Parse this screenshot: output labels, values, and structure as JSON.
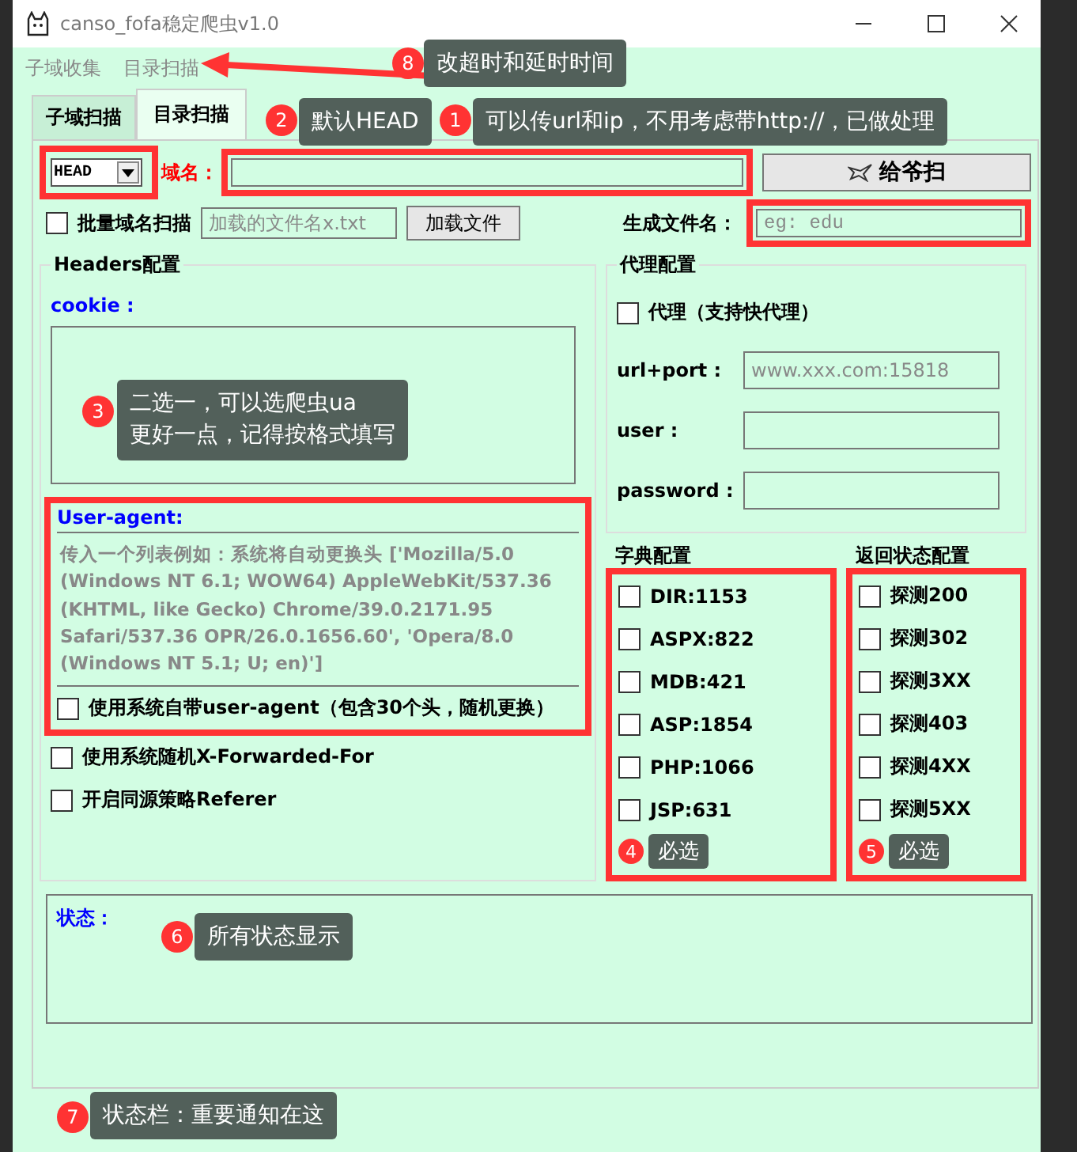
{
  "window": {
    "title": "canso_fofa稳定爬虫v1.0"
  },
  "menu": [
    {
      "label": "子域收集"
    },
    {
      "label": "目录扫描"
    }
  ],
  "tabs": [
    {
      "label": "子域扫描",
      "selected": false
    },
    {
      "label": "目录扫描",
      "selected": true
    }
  ],
  "scan_row": {
    "method": "HEAD",
    "domain_label": "域名：",
    "scan_button": "给爷扫"
  },
  "file_row": {
    "batch": {
      "label": "批量域名扫描",
      "checked": false
    },
    "file_placeholder": "加载的文件名x.txt",
    "load_button": "加载文件",
    "output_label": "生成文件名：",
    "output_placeholder": "eg: edu"
  },
  "headers": {
    "title": "Headers配置",
    "cookie_label": "cookie :",
    "ua_label": "User-agent:",
    "ua_placeholder": "传入一个列表例如：系统将自动更换头 ['Mozilla/5.0 (Windows NT 6.1; WOW64) AppleWebKit/537.36 (KHTML, like Gecko) Chrome/39.0.2171.95 Safari/537.36 OPR/26.0.1656.60', 'Opera/8.0 (Windows NT 5.1; U; en)']",
    "options": [
      {
        "label": "使用系统自带user-agent（包含30个头，随机更换）",
        "checked": false
      },
      {
        "label": "使用系统随机X-Forwarded-For",
        "checked": false
      },
      {
        "label": "开启同源策略Referer",
        "checked": false
      }
    ]
  },
  "proxy": {
    "title": "代理配置",
    "enable": {
      "label": "代理（支持快代理）",
      "checked": false
    },
    "fields": [
      {
        "label": "url+port :",
        "placeholder": "www.xxx.com:15818"
      },
      {
        "label": "user :"
      },
      {
        "label": "password :"
      }
    ]
  },
  "dictionary": {
    "title": "字典配置",
    "items": [
      {
        "label": "DIR:1153",
        "checked": false
      },
      {
        "label": "ASPX:822",
        "checked": false
      },
      {
        "label": "MDB:421",
        "checked": false
      },
      {
        "label": "ASP:1854",
        "checked": false
      },
      {
        "label": "PHP:1066",
        "checked": false
      },
      {
        "label": "JSP:631",
        "checked": false
      }
    ]
  },
  "status_codes": {
    "title": "返回状态配置",
    "items": [
      {
        "label": "探测200",
        "checked": false
      },
      {
        "label": "探测302",
        "checked": false
      },
      {
        "label": "探测3XX",
        "checked": false
      },
      {
        "label": "探测403",
        "checked": false
      },
      {
        "label": "探测4XX",
        "checked": false
      },
      {
        "label": "探测5XX",
        "checked": false
      }
    ]
  },
  "status_box": {
    "label": "状态："
  },
  "annotations": [
    {
      "number": "8",
      "text": "改超时和延时时间"
    },
    {
      "number": "2",
      "text": "默认HEAD"
    },
    {
      "number": "1",
      "text": "可以传url和ip，不用考虑带http://，已做处理"
    },
    {
      "number": "3",
      "text": "二选一，可以选爬虫ua\n更好一点，记得按格式填写"
    },
    {
      "number": "4",
      "text": "必选"
    },
    {
      "number": "5",
      "text": "必选"
    },
    {
      "number": "6",
      "text": "所有状态显示"
    },
    {
      "number": "7",
      "text": "状态栏：重要通知在这"
    }
  ]
}
